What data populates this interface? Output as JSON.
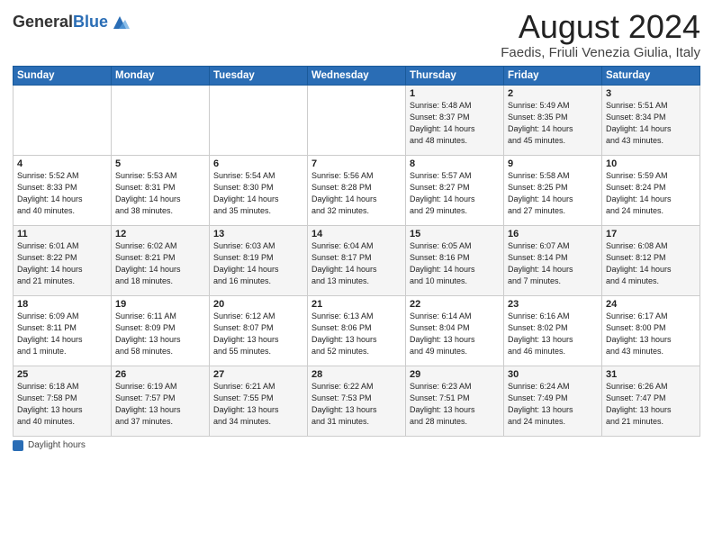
{
  "header": {
    "logo_general": "General",
    "logo_blue": "Blue",
    "title": "August 2024",
    "subtitle": "Faedis, Friuli Venezia Giulia, Italy"
  },
  "days_of_week": [
    "Sunday",
    "Monday",
    "Tuesday",
    "Wednesday",
    "Thursday",
    "Friday",
    "Saturday"
  ],
  "weeks": [
    [
      {
        "day": "",
        "info": ""
      },
      {
        "day": "",
        "info": ""
      },
      {
        "day": "",
        "info": ""
      },
      {
        "day": "",
        "info": ""
      },
      {
        "day": "1",
        "info": "Sunrise: 5:48 AM\nSunset: 8:37 PM\nDaylight: 14 hours\nand 48 minutes."
      },
      {
        "day": "2",
        "info": "Sunrise: 5:49 AM\nSunset: 8:35 PM\nDaylight: 14 hours\nand 45 minutes."
      },
      {
        "day": "3",
        "info": "Sunrise: 5:51 AM\nSunset: 8:34 PM\nDaylight: 14 hours\nand 43 minutes."
      }
    ],
    [
      {
        "day": "4",
        "info": "Sunrise: 5:52 AM\nSunset: 8:33 PM\nDaylight: 14 hours\nand 40 minutes."
      },
      {
        "day": "5",
        "info": "Sunrise: 5:53 AM\nSunset: 8:31 PM\nDaylight: 14 hours\nand 38 minutes."
      },
      {
        "day": "6",
        "info": "Sunrise: 5:54 AM\nSunset: 8:30 PM\nDaylight: 14 hours\nand 35 minutes."
      },
      {
        "day": "7",
        "info": "Sunrise: 5:56 AM\nSunset: 8:28 PM\nDaylight: 14 hours\nand 32 minutes."
      },
      {
        "day": "8",
        "info": "Sunrise: 5:57 AM\nSunset: 8:27 PM\nDaylight: 14 hours\nand 29 minutes."
      },
      {
        "day": "9",
        "info": "Sunrise: 5:58 AM\nSunset: 8:25 PM\nDaylight: 14 hours\nand 27 minutes."
      },
      {
        "day": "10",
        "info": "Sunrise: 5:59 AM\nSunset: 8:24 PM\nDaylight: 14 hours\nand 24 minutes."
      }
    ],
    [
      {
        "day": "11",
        "info": "Sunrise: 6:01 AM\nSunset: 8:22 PM\nDaylight: 14 hours\nand 21 minutes."
      },
      {
        "day": "12",
        "info": "Sunrise: 6:02 AM\nSunset: 8:21 PM\nDaylight: 14 hours\nand 18 minutes."
      },
      {
        "day": "13",
        "info": "Sunrise: 6:03 AM\nSunset: 8:19 PM\nDaylight: 14 hours\nand 16 minutes."
      },
      {
        "day": "14",
        "info": "Sunrise: 6:04 AM\nSunset: 8:17 PM\nDaylight: 14 hours\nand 13 minutes."
      },
      {
        "day": "15",
        "info": "Sunrise: 6:05 AM\nSunset: 8:16 PM\nDaylight: 14 hours\nand 10 minutes."
      },
      {
        "day": "16",
        "info": "Sunrise: 6:07 AM\nSunset: 8:14 PM\nDaylight: 14 hours\nand 7 minutes."
      },
      {
        "day": "17",
        "info": "Sunrise: 6:08 AM\nSunset: 8:12 PM\nDaylight: 14 hours\nand 4 minutes."
      }
    ],
    [
      {
        "day": "18",
        "info": "Sunrise: 6:09 AM\nSunset: 8:11 PM\nDaylight: 14 hours\nand 1 minute."
      },
      {
        "day": "19",
        "info": "Sunrise: 6:11 AM\nSunset: 8:09 PM\nDaylight: 13 hours\nand 58 minutes."
      },
      {
        "day": "20",
        "info": "Sunrise: 6:12 AM\nSunset: 8:07 PM\nDaylight: 13 hours\nand 55 minutes."
      },
      {
        "day": "21",
        "info": "Sunrise: 6:13 AM\nSunset: 8:06 PM\nDaylight: 13 hours\nand 52 minutes."
      },
      {
        "day": "22",
        "info": "Sunrise: 6:14 AM\nSunset: 8:04 PM\nDaylight: 13 hours\nand 49 minutes."
      },
      {
        "day": "23",
        "info": "Sunrise: 6:16 AM\nSunset: 8:02 PM\nDaylight: 13 hours\nand 46 minutes."
      },
      {
        "day": "24",
        "info": "Sunrise: 6:17 AM\nSunset: 8:00 PM\nDaylight: 13 hours\nand 43 minutes."
      }
    ],
    [
      {
        "day": "25",
        "info": "Sunrise: 6:18 AM\nSunset: 7:58 PM\nDaylight: 13 hours\nand 40 minutes."
      },
      {
        "day": "26",
        "info": "Sunrise: 6:19 AM\nSunset: 7:57 PM\nDaylight: 13 hours\nand 37 minutes."
      },
      {
        "day": "27",
        "info": "Sunrise: 6:21 AM\nSunset: 7:55 PM\nDaylight: 13 hours\nand 34 minutes."
      },
      {
        "day": "28",
        "info": "Sunrise: 6:22 AM\nSunset: 7:53 PM\nDaylight: 13 hours\nand 31 minutes."
      },
      {
        "day": "29",
        "info": "Sunrise: 6:23 AM\nSunset: 7:51 PM\nDaylight: 13 hours\nand 28 minutes."
      },
      {
        "day": "30",
        "info": "Sunrise: 6:24 AM\nSunset: 7:49 PM\nDaylight: 13 hours\nand 24 minutes."
      },
      {
        "day": "31",
        "info": "Sunrise: 6:26 AM\nSunset: 7:47 PM\nDaylight: 13 hours\nand 21 minutes."
      }
    ]
  ],
  "footer": {
    "daylight_label": "Daylight hours"
  }
}
